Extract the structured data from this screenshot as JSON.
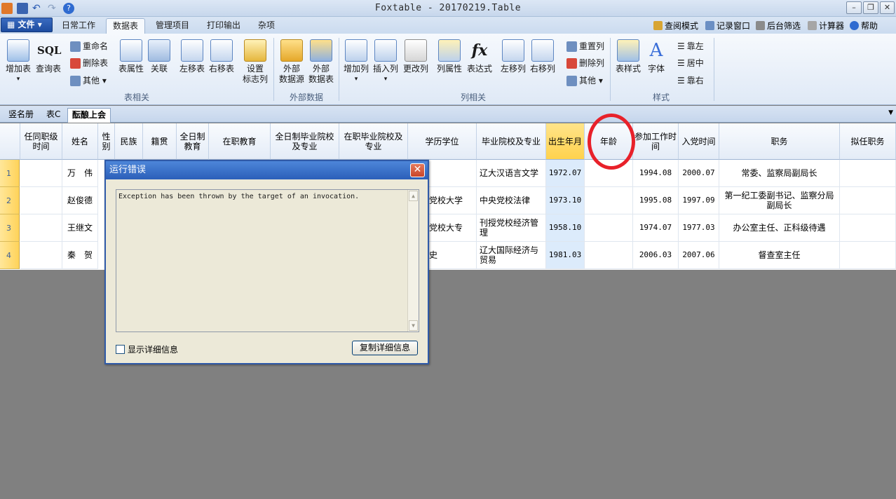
{
  "window": {
    "title": "Foxtable - 20170219.Table"
  },
  "menu": {
    "file_label": "文件",
    "tabs": [
      "日常工作",
      "数据表",
      "管理项目",
      "打印输出",
      "杂项"
    ]
  },
  "toplinks": [
    "查阅模式",
    "记录窗口",
    "后台筛选",
    "计算器",
    "帮助"
  ],
  "ribbon": {
    "add_table": "增加表",
    "query_table": "查询表",
    "rename": "重命名",
    "delete_table": "删除表",
    "other1": "其他",
    "table_props": "表属性",
    "relation": "关联",
    "move_left_table": "左移表",
    "move_right_table": "右移表",
    "flag_col_1": "设置",
    "flag_col_2": "标志列",
    "ext_source_1": "外部",
    "ext_source_2": "数据源",
    "ext_table_1": "外部",
    "ext_table_2": "数据表",
    "add_col": "增加列",
    "insert_col": "插入列",
    "change_col": "更改列",
    "col_props": "列属性",
    "expression": "表达式",
    "move_left_col": "左移列",
    "move_right_col": "右移列",
    "reset_col": "重置列",
    "delete_col": "删除列",
    "other2": "其他",
    "table_style": "表样式",
    "font": "字体",
    "align_left": "靠左",
    "align_center": "居中",
    "align_right": "靠右",
    "group_table": "表相关",
    "group_external": "外部数据",
    "group_column": "列相关",
    "group_style": "样式"
  },
  "sheets": [
    "竖名册",
    "表C",
    "酝酿上会"
  ],
  "columns": [
    "任同职级时间",
    "姓名",
    "性别",
    "民族",
    "籍贯",
    "全日制教育",
    "在职教育",
    "全日制毕业院校及专业",
    "在职毕业院校及专业",
    "学历学位",
    "毕业院校及专业",
    "出生年月",
    "年龄",
    "参加工作时间",
    "入党时间",
    "职务",
    "拟任职务"
  ],
  "rows": [
    {
      "num": "1",
      "name": "万　伟",
      "school_partial": "",
      "major": "辽大汉语言文学",
      "birth": "1972.07",
      "work": "1994.08",
      "party": "2000.07",
      "post": "常委、监察局副局长"
    },
    {
      "num": "2",
      "name": "赵俊德",
      "school_partial": "党校大学",
      "major": "中央党校法律",
      "birth": "1973.10",
      "work": "1995.08",
      "party": "1997.09",
      "post": "第一纪工委副书记、监察分局副局长"
    },
    {
      "num": "3",
      "name": "王继文",
      "school_partial": "党校大专",
      "major": "刊授党校经济管理",
      "birth": "1958.10",
      "work": "1974.07",
      "party": "1977.03",
      "post": "办公室主任、正科级待遇"
    },
    {
      "num": "4",
      "name": "秦　贺",
      "school_partial": "史",
      "major": "辽大国际经济与贸易",
      "birth": "1981.03",
      "work": "2006.03",
      "party": "2007.06",
      "post": "督查室主任"
    }
  ],
  "dialog": {
    "title": "运行错误",
    "message": "Exception has been thrown by the target of an invocation.",
    "show_details": "显示详细信息",
    "copy_details": "复制详细信息"
  }
}
